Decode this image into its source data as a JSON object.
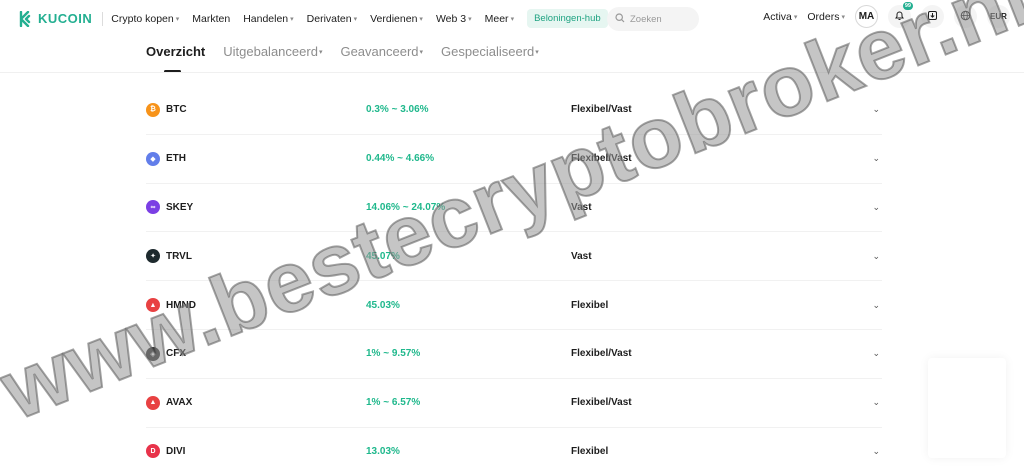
{
  "brand": {
    "logo_text": "KUCOIN",
    "accent_color": "#23af91"
  },
  "nav": {
    "items": [
      {
        "label": "Crypto kopen",
        "has_caret": true
      },
      {
        "label": "Markten",
        "has_caret": false
      },
      {
        "label": "Handelen",
        "has_caret": true
      },
      {
        "label": "Derivaten",
        "has_caret": true
      },
      {
        "label": "Verdienen",
        "has_caret": true
      },
      {
        "label": "Web 3",
        "has_caret": true
      },
      {
        "label": "Meer",
        "has_caret": true
      }
    ],
    "rewards_label": "Beloningen-hub"
  },
  "search": {
    "placeholder": "Zoeken",
    "value": ""
  },
  "right_nav": {
    "assets_label": "Activa",
    "orders_label": "Orders",
    "avatar_initials": "MA",
    "notification_count": "99",
    "currency_label": "EUR",
    "icons": [
      "bell-icon",
      "download-icon",
      "globe-icon"
    ]
  },
  "tabs": [
    {
      "label": "Overzicht",
      "active": true,
      "has_caret": false
    },
    {
      "label": "Uitgebalanceerd",
      "active": false,
      "has_caret": true
    },
    {
      "label": "Geavanceerd",
      "active": false,
      "has_caret": true
    },
    {
      "label": "Gespecialiseerd",
      "active": false,
      "has_caret": true
    }
  ],
  "rows": [
    {
      "coin": "BTC",
      "apr": "0.3% ~ 3.06%",
      "term": "Flexibel/Vast",
      "icon_color": "#f7931a",
      "icon_glyph": "₿"
    },
    {
      "coin": "ETH",
      "apr": "0.44% ~ 4.66%",
      "term": "Flexibel/Vast",
      "icon_color": "#627eea",
      "icon_glyph": "◆"
    },
    {
      "coin": "SKEY",
      "apr": "14.06% ~ 24.07%",
      "term": "Vast",
      "icon_color": "#7b3fe4",
      "icon_glyph": "∞"
    },
    {
      "coin": "TRVL",
      "apr": "45.07%",
      "term": "Vast",
      "icon_color": "#1e2a2e",
      "icon_glyph": "✦"
    },
    {
      "coin": "HMND",
      "apr": "45.03%",
      "term": "Flexibel",
      "icon_color": "#e84142",
      "icon_glyph": "▲"
    },
    {
      "coin": "CFX",
      "apr": "1% ~ 9.57%",
      "term": "Flexibel/Vast",
      "icon_color": "#2f2f2f",
      "icon_glyph": "◈"
    },
    {
      "coin": "AVAX",
      "apr": "1% ~ 6.57%",
      "term": "Flexibel/Vast",
      "icon_color": "#e84142",
      "icon_glyph": "▲"
    },
    {
      "coin": "DIVI",
      "apr": "13.03%",
      "term": "Flexibel",
      "icon_color": "#e8334a",
      "icon_glyph": "D"
    }
  ],
  "watermark_text": "www.bestecryptobroker.nl"
}
